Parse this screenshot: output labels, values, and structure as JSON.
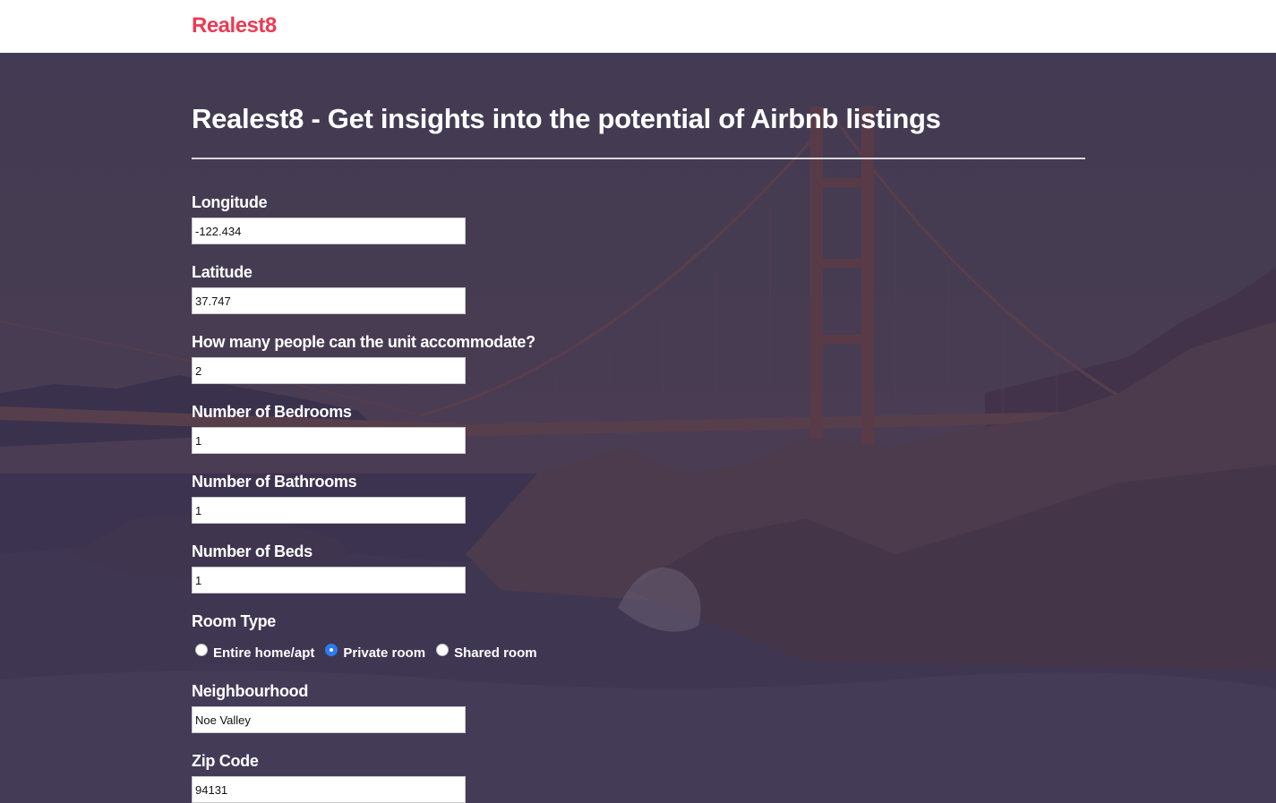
{
  "header": {
    "brand": "Realest8"
  },
  "main": {
    "title": "Realest8 - Get insights into the potential of Airbnb listings",
    "fields": [
      {
        "label": "Longitude",
        "value": "-122.434"
      },
      {
        "label": "Latitude",
        "value": "37.747"
      },
      {
        "label": "How many people can the unit accommodate?",
        "value": "2"
      },
      {
        "label": "Number of Bedrooms",
        "value": "1"
      },
      {
        "label": "Number of Bathrooms",
        "value": "1"
      },
      {
        "label": "Number of Beds",
        "value": "1"
      }
    ],
    "room_type": {
      "label": "Room Type",
      "options": [
        {
          "label": "Entire home/apt",
          "checked": false
        },
        {
          "label": "Private room",
          "checked": true
        },
        {
          "label": "Shared room",
          "checked": false
        }
      ]
    },
    "neighbourhood": {
      "label": "Neighbourhood",
      "value": "Noe Valley"
    },
    "zip_code": {
      "label": "Zip Code",
      "value": "94131"
    }
  },
  "colors": {
    "brand": "#ec3a55",
    "overlay": "#4a3d5c",
    "radio_checked": "#2b7bf0"
  }
}
